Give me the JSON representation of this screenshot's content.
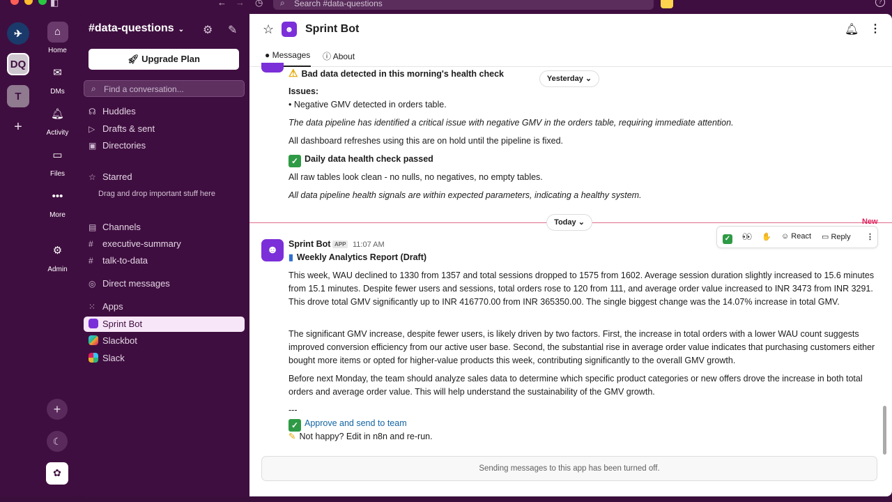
{
  "search": {
    "placeholder": "Search #data-questions"
  },
  "rail": {
    "workspaces": [
      "DQ",
      "T"
    ],
    "nav": [
      {
        "label": "Home",
        "icon": "home-icon"
      },
      {
        "label": "DMs",
        "icon": "dms-icon"
      },
      {
        "label": "Activity",
        "icon": "bell-icon"
      },
      {
        "label": "Files",
        "icon": "files-icon"
      },
      {
        "label": "More",
        "icon": "more-icon"
      },
      {
        "label": "Admin",
        "icon": "gear-icon"
      }
    ]
  },
  "sidebar": {
    "workspace_title": "#data-questions",
    "upgrade_label": "Upgrade Plan",
    "find_placeholder": "Find a conversation...",
    "items": [
      "Huddles",
      "Drafts & sent",
      "Directories"
    ],
    "starred": {
      "label": "Starred",
      "hint": "Drag and drop important stuff here"
    },
    "channels": {
      "label": "Channels",
      "list": [
        "executive-summary",
        "talk-to-data"
      ]
    },
    "direct_messages": "Direct messages",
    "apps": {
      "label": "Apps",
      "list": [
        "Sprint Bot",
        "Slackbot",
        "Slack"
      ]
    }
  },
  "header": {
    "title": "Sprint Bot",
    "tabs": [
      "Messages",
      "About"
    ]
  },
  "previous_message": {
    "alert_title": "Bad data detected in this morning's health check",
    "issues_label": "Issues:",
    "issue_item": "• Negative GMV detected in orders table.",
    "alert_summary": "The data pipeline has identified a critical issue with negative GMV in the orders table, requiring immediate attention.",
    "alert_note": "All dashboard refreshes using this are on hold until the pipeline is fixed.",
    "pass_title": "Daily data health check passed",
    "pass_detail": "All raw tables look clean - no nulls, no negatives, no empty tables.",
    "pass_summary": "All data pipeline health signals are within expected parameters, indicating a healthy system."
  },
  "date_pills": {
    "yesterday": "Yesterday",
    "today": "Today"
  },
  "new_label": "New",
  "message": {
    "sender": "Sprint Bot",
    "badge": "APP",
    "time": "11:07 AM",
    "title": "Weekly Analytics Report (Draft)",
    "para1": "This week, WAU declined to 1330 from 1357 and total sessions dropped to 1575 from 1602. Average session duration slightly increased to 15.6 minutes from 15.1 minutes. Despite fewer users and sessions, total orders rose to 120 from 111, and average order value increased to INR 3473 from INR 3291. This drove total GMV significantly up to INR 416770.00 from INR 365350.00. The single biggest change was the 14.07% increase in total GMV.",
    "para2": "The significant GMV increase, despite fewer users, is likely driven by two factors. First, the increase in total orders with a lower WAU count suggests improved conversion efficiency from our active user base. Second, the substantial rise in average order value indicates that purchasing customers either bought more items or opted for higher-value products this week, contributing significantly to the overall GMV growth.",
    "para3": "Before next Monday, the team should analyze sales data to determine which specific product categories or new offers drove the increase in both total orders and average order value. This will help understand the sustainability of the GMV growth.",
    "separator": "---",
    "approve_link": "Approve and send to team",
    "edit_text": "Not happy? Edit in n8n and re-run."
  },
  "actions": {
    "react": "React",
    "reply": "Reply"
  },
  "composer": {
    "disabled_text": "Sending messages to this app has been turned off."
  },
  "colors": {
    "aubergine": "#3f0e40",
    "link": "#1264a3",
    "new_divider": "#e01e5a",
    "check": "#2e9a45"
  }
}
